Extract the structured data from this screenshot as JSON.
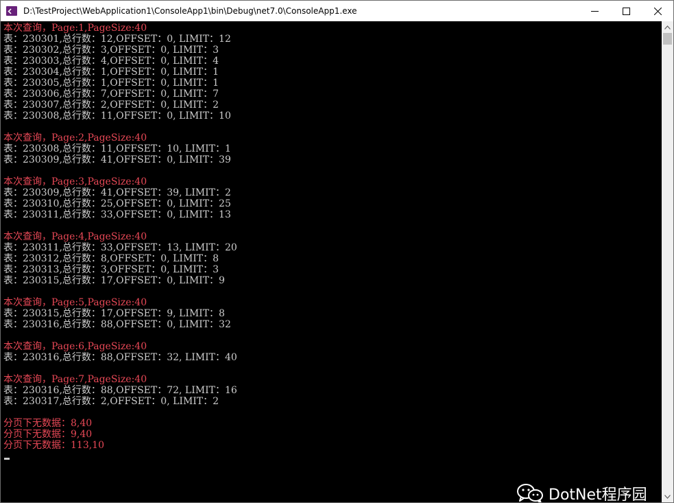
{
  "window": {
    "title": "D:\\TestProject\\WebApplication1\\ConsoleApp1\\bin\\Debug\\net7.0\\ConsoleApp1.exe",
    "icon": "visual-studio-console-icon",
    "controls": [
      "minimize-icon",
      "maximize-icon",
      "close-icon"
    ]
  },
  "colors": {
    "error_text": "#e74856",
    "normal_text": "#cccccc",
    "background": "#000000"
  },
  "console": {
    "lines": [
      {
        "text": "本次查询，Page:1,PageSize:40",
        "color": "red"
      },
      {
        "text": "表：230301,总行数：12,OFFSET：0, LIMIT：12",
        "color": "white"
      },
      {
        "text": "表：230302,总行数：3,OFFSET：0, LIMIT：3",
        "color": "white"
      },
      {
        "text": "表：230303,总行数：4,OFFSET：0, LIMIT：4",
        "color": "white"
      },
      {
        "text": "表：230304,总行数：1,OFFSET：0, LIMIT：1",
        "color": "white"
      },
      {
        "text": "表：230305,总行数：1,OFFSET：0, LIMIT：1",
        "color": "white"
      },
      {
        "text": "表：230306,总行数：7,OFFSET：0, LIMIT：7",
        "color": "white"
      },
      {
        "text": "表：230307,总行数：2,OFFSET：0, LIMIT：2",
        "color": "white"
      },
      {
        "text": "表：230308,总行数：11,OFFSET：0, LIMIT：10",
        "color": "white"
      },
      {
        "text": "",
        "color": "white"
      },
      {
        "text": "本次查询，Page:2,PageSize:40",
        "color": "red"
      },
      {
        "text": "表：230308,总行数：11,OFFSET：10, LIMIT：1",
        "color": "white"
      },
      {
        "text": "表：230309,总行数：41,OFFSET：0, LIMIT：39",
        "color": "white"
      },
      {
        "text": "",
        "color": "white"
      },
      {
        "text": "本次查询，Page:3,PageSize:40",
        "color": "red"
      },
      {
        "text": "表：230309,总行数：41,OFFSET：39, LIMIT：2",
        "color": "white"
      },
      {
        "text": "表：230310,总行数：25,OFFSET：0, LIMIT：25",
        "color": "white"
      },
      {
        "text": "表：230311,总行数：33,OFFSET：0, LIMIT：13",
        "color": "white"
      },
      {
        "text": "",
        "color": "white"
      },
      {
        "text": "本次查询，Page:4,PageSize:40",
        "color": "red"
      },
      {
        "text": "表：230311,总行数：33,OFFSET：13, LIMIT：20",
        "color": "white"
      },
      {
        "text": "表：230312,总行数：8,OFFSET：0, LIMIT：8",
        "color": "white"
      },
      {
        "text": "表：230313,总行数：3,OFFSET：0, LIMIT：3",
        "color": "white"
      },
      {
        "text": "表：230315,总行数：17,OFFSET：0, LIMIT：9",
        "color": "white"
      },
      {
        "text": "",
        "color": "white"
      },
      {
        "text": "本次查询，Page:5,PageSize:40",
        "color": "red"
      },
      {
        "text": "表：230315,总行数：17,OFFSET：9, LIMIT：8",
        "color": "white"
      },
      {
        "text": "表：230316,总行数：88,OFFSET：0, LIMIT：32",
        "color": "white"
      },
      {
        "text": "",
        "color": "white"
      },
      {
        "text": "本次查询，Page:6,PageSize:40",
        "color": "red"
      },
      {
        "text": "表：230316,总行数：88,OFFSET：32, LIMIT：40",
        "color": "white"
      },
      {
        "text": "",
        "color": "white"
      },
      {
        "text": "本次查询，Page:7,PageSize:40",
        "color": "red"
      },
      {
        "text": "表：230316,总行数：88,OFFSET：72, LIMIT：16",
        "color": "white"
      },
      {
        "text": "表：230317,总行数：2,OFFSET：0, LIMIT：2",
        "color": "white"
      },
      {
        "text": "",
        "color": "white"
      },
      {
        "text": "分页下无数据：8,40",
        "color": "red"
      },
      {
        "text": "分页下无数据：9,40",
        "color": "red"
      },
      {
        "text": "分页下无数据：113,10",
        "color": "red"
      }
    ]
  },
  "scrollbar": {
    "up_icon": "scroll-up-arrow-icon",
    "down_icon": "scroll-down-arrow-icon"
  },
  "watermark": {
    "icon": "wechat-logo-icon",
    "text": "DotNet程序园"
  }
}
